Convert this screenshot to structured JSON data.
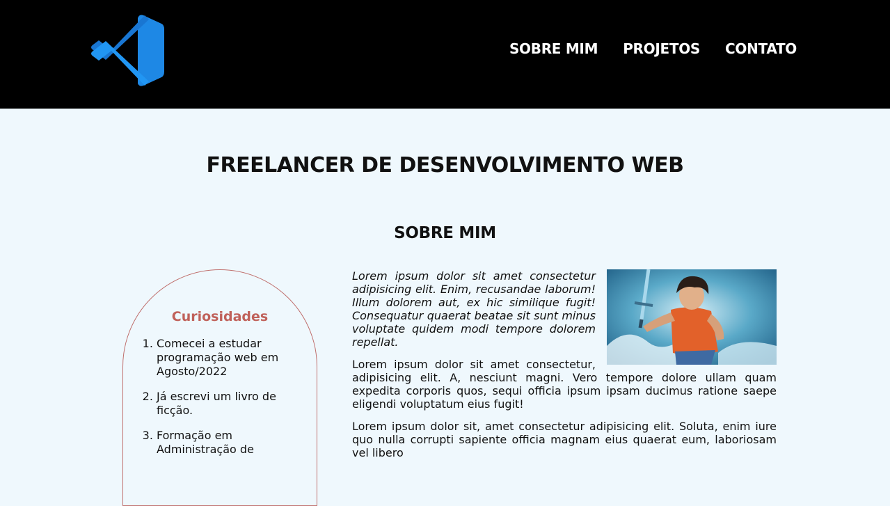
{
  "header": {
    "logo_icon": "vscode-logo",
    "nav": [
      {
        "label": "SOBRE MIM"
      },
      {
        "label": "PROJETOS"
      },
      {
        "label": "CONTATO"
      }
    ]
  },
  "hero": {
    "title": "FREELANCER DE DESENVOLVIMENTO WEB"
  },
  "about": {
    "title": "SOBRE MIM",
    "curiosities": {
      "title": "Curiosidades",
      "items": [
        "Comecei a estudar programação web em Agosto/2022",
        "Já escrevi um livro de ficção.",
        "Formação em Administração de"
      ]
    },
    "image_alt": "ilustração de personagem com espada",
    "paragraphs": [
      "Lorem ipsum dolor sit amet consectetur adipisicing elit. Enim, recusandae laborum! Illum dolorem aut, ex hic similique fugit! Consequatur quaerat beatae sit sunt minus voluptate quidem modi tempore dolorem repellat.",
      "Lorem ipsum dolor sit amet consectetur, adipisicing elit. A, nesciunt magni. Vero tempore dolore ullam quam expedita corporis quos, sequi officia ipsum ipsam ducimus ratione saepe eligendi voluptatum eius fugit!",
      "Lorem ipsum dolor sit, amet consectetur adipisicing elit. Soluta, enim iure quo nulla corrupti sapiente officia magnam eius quaerat eum, laboriosam vel libero"
    ]
  },
  "colors": {
    "header_bg": "#000000",
    "page_bg": "#eff8fd",
    "accent": "#c0615a",
    "logo_blue": "#1e88e5"
  }
}
